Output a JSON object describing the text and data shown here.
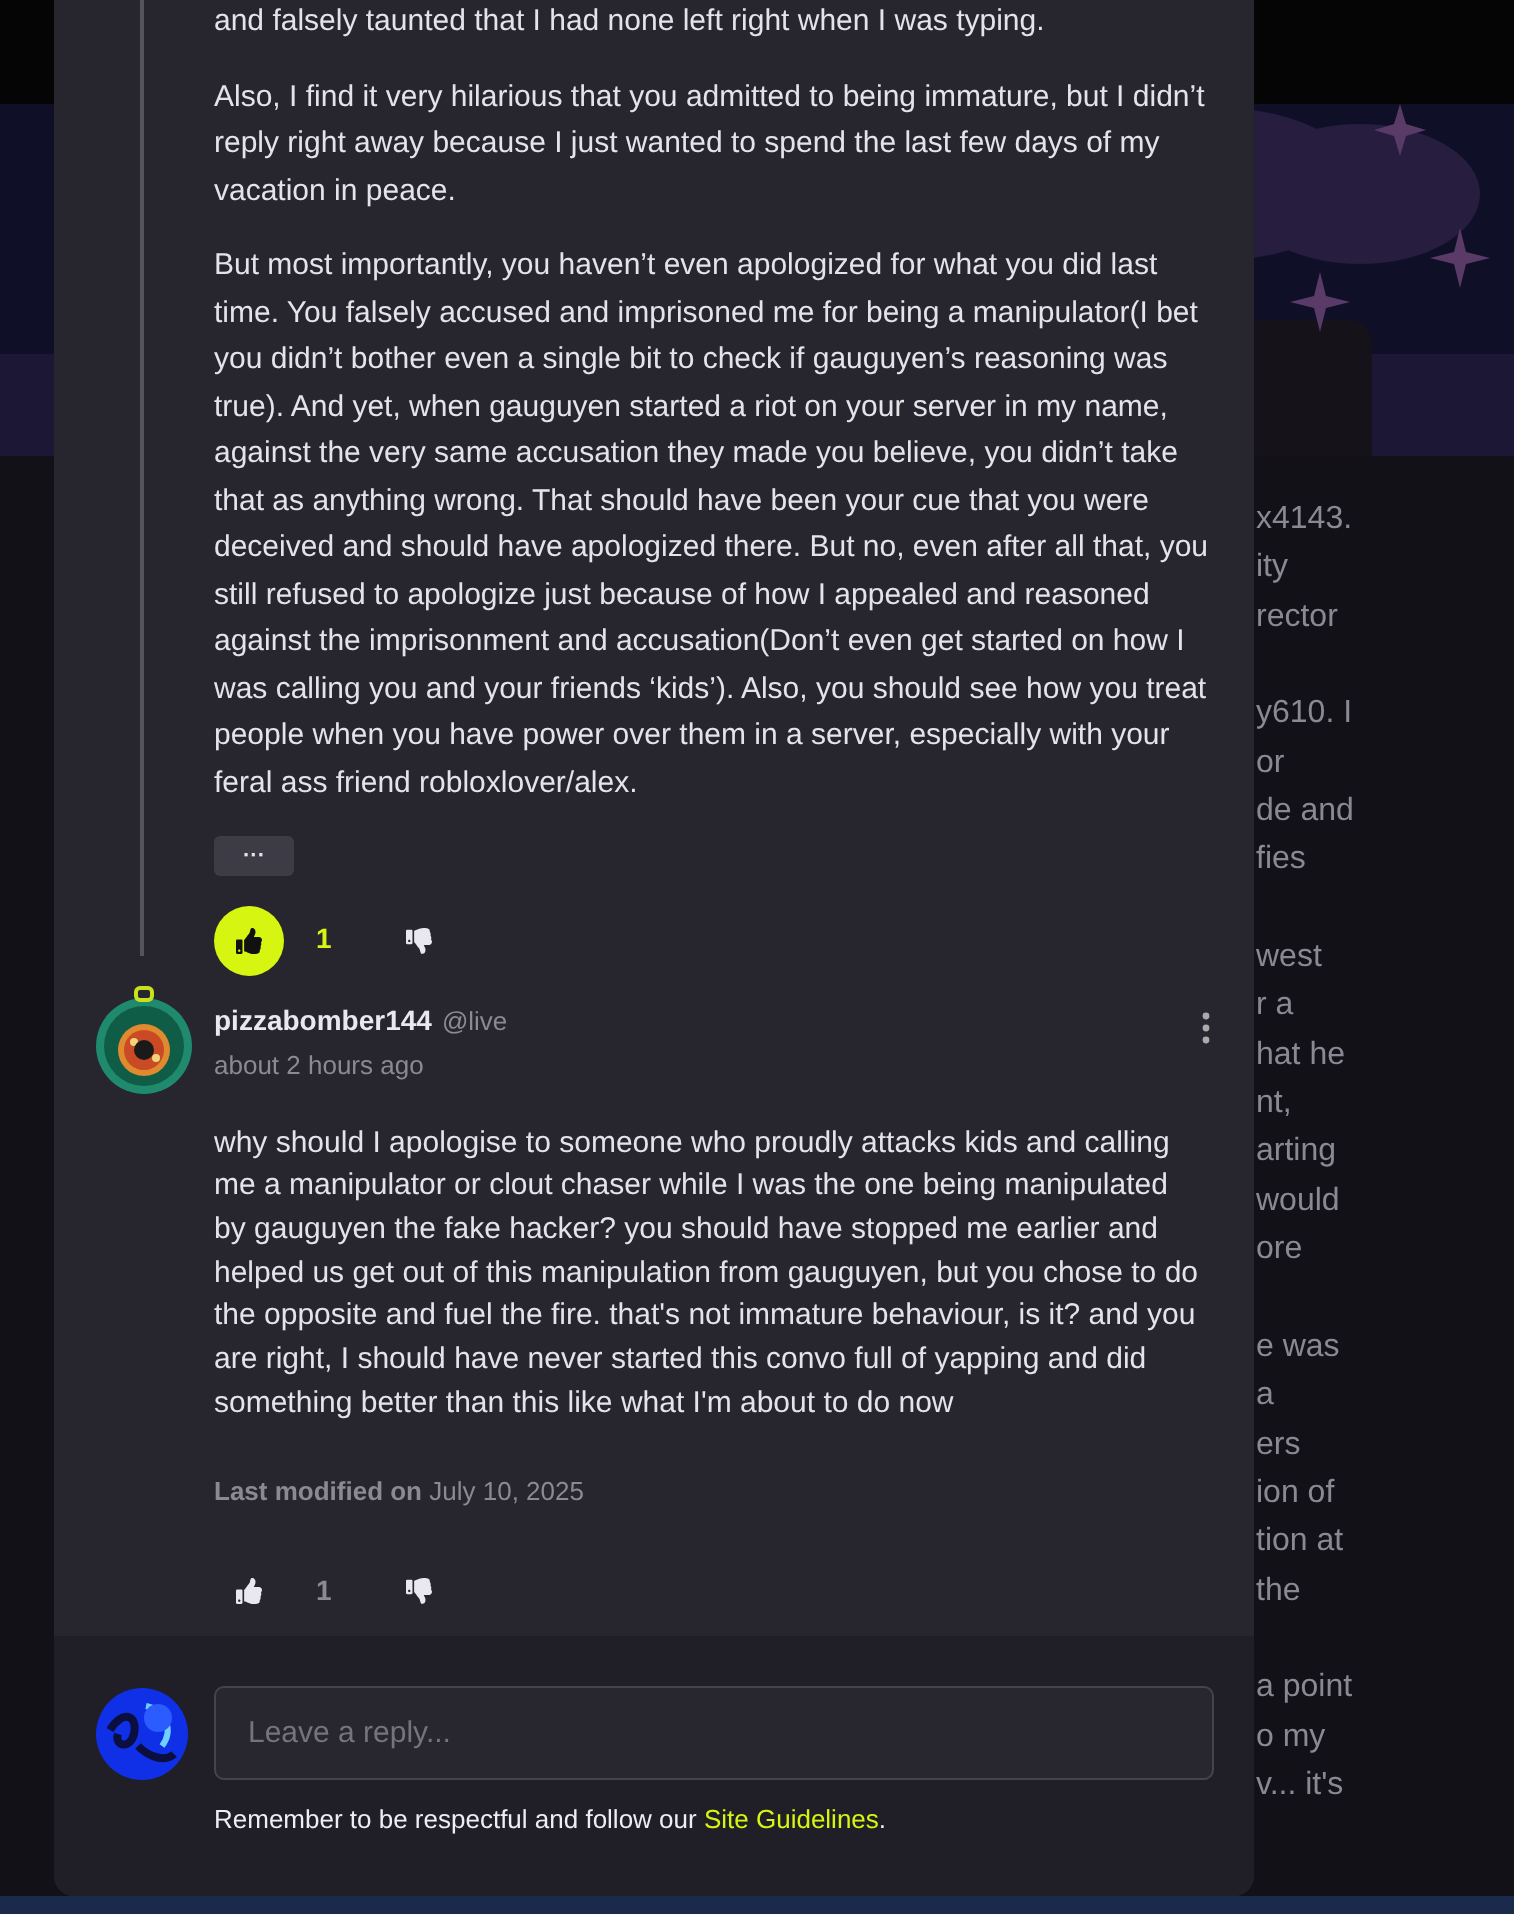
{
  "background": {
    "paragraphs": [
      [
        "x4143.",
        "ity",
        "rector"
      ],
      [
        "y610. I",
        "or",
        "de and",
        "fies"
      ],
      [
        "west",
        "r a",
        "hat he",
        "nt,",
        "arting",
        "would",
        "ore"
      ],
      [
        "e was",
        "a",
        "ers",
        "ion of",
        "tion at",
        "the"
      ],
      [
        "a point",
        "o my",
        "v... it's"
      ]
    ]
  },
  "comments": [
    {
      "paragraphs": [
        "and falsely taunted that I had none left right when I was typing.",
        "Also, I find it very hilarious that you admitted to being immature, but I didn’t reply right away because I just wanted to spend the last few days of my vacation in peace.",
        "But most importantly, you haven’t even apologized for what you did last time. You falsely accused and imprisoned me for being a manipulator(I bet you didn’t bother even a single bit to check if gauguyen’s reasoning was true). And yet, when gauguyen started a riot on your server in my name, against the very same accusation they made you believe, you didn’t take that as anything wrong. That should have been your cue that you were deceived and should have apologized there. But no, even after all that, you still refused to apologize just because of how I appealed and reasoned against the imprisonment and accusation(Don’t even get started on how I was calling you and your friends ‘kids’). Also, you should see how you treat people when you have power over them in a server, especially with your feral ass friend robloxlover/alex."
      ],
      "more_button": "···",
      "liked": true,
      "likes": "1"
    },
    {
      "author": "pizzabomber144",
      "handle": "@live",
      "time": "about 2 hours ago",
      "paragraphs": [
        "why should I apologise to someone who proudly attacks kids and calling me a manipulator or clout chaser while I was the one being manipulated by gauguyen the fake hacker? you should have stopped me earlier and helped us get out of this manipulation from gauguyen, but you chose to do the opposite and fuel the fire. that's not immature behaviour, is it? and you are right, I should have never started this convo full of yapping and did something better than this like what I'm about to do now"
      ],
      "modified_label": "Last modified on",
      "modified_date": "July 10, 2025",
      "liked": false,
      "likes": "1"
    }
  ],
  "reply": {
    "placeholder": "Leave a reply...",
    "note": "Remember to be respectful and follow our ",
    "link": "Site Guidelines",
    "note_end": "."
  }
}
